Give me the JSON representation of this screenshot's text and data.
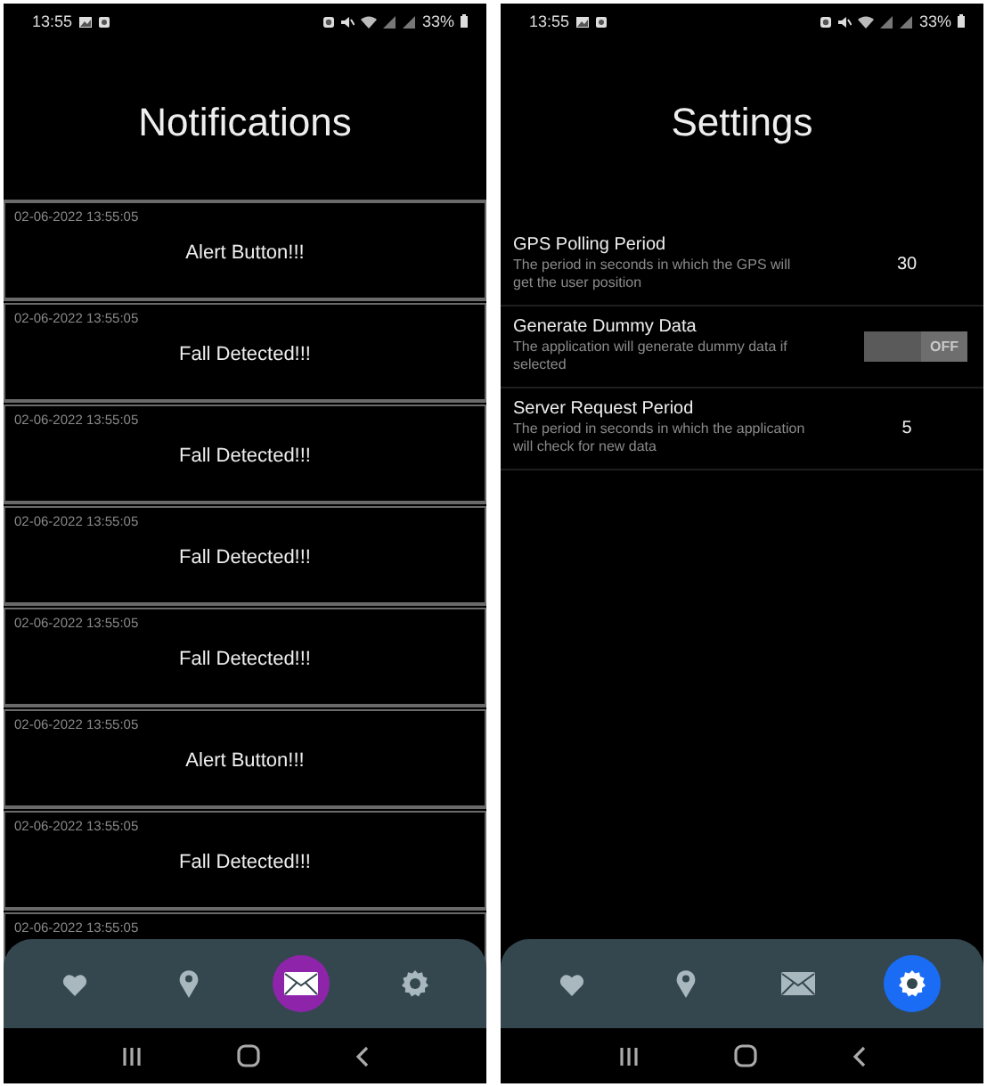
{
  "screens": [
    {
      "status_bar": {
        "time": "13:55",
        "battery": "33%"
      },
      "title": "Notifications",
      "notifications": [
        {
          "time": "02-06-2022 13:55:05",
          "message": "Alert Button!!!"
        },
        {
          "time": "02-06-2022 13:55:05",
          "message": "Fall Detected!!!"
        },
        {
          "time": "02-06-2022 13:55:05",
          "message": "Fall Detected!!!"
        },
        {
          "time": "02-06-2022 13:55:05",
          "message": "Fall Detected!!!"
        },
        {
          "time": "02-06-2022 13:55:05",
          "message": "Fall Detected!!!"
        },
        {
          "time": "02-06-2022 13:55:05",
          "message": "Alert Button!!!"
        },
        {
          "time": "02-06-2022 13:55:05",
          "message": "Fall Detected!!!"
        },
        {
          "time": "02-06-2022 13:55:05"
        }
      ],
      "bottom_nav": [
        {
          "kind": "heart",
          "selected": false
        },
        {
          "kind": "pin",
          "selected": false
        },
        {
          "kind": "mail",
          "selected": true,
          "color": "#8e24aa"
        },
        {
          "kind": "gear",
          "selected": false
        }
      ]
    },
    {
      "status_bar": {
        "time": "13:55",
        "battery": "33%"
      },
      "title": "Settings",
      "settings": [
        {
          "kind": "value",
          "title": "GPS Polling Period",
          "description": "The period in seconds in which the GPS will get the user position",
          "value": "30"
        },
        {
          "kind": "toggle",
          "title": "Generate Dummy Data",
          "description": "The application will generate dummy data if selected",
          "on": false,
          "toggle_label": "OFF"
        },
        {
          "kind": "value",
          "title": "Server Request Period",
          "description": "The period in seconds in which the application will check for new data",
          "value": "5"
        }
      ],
      "bottom_nav": [
        {
          "kind": "heart",
          "selected": false
        },
        {
          "kind": "pin",
          "selected": false
        },
        {
          "kind": "mail",
          "selected": false
        },
        {
          "kind": "gear",
          "selected": true,
          "color": "#1a6cf5"
        }
      ]
    }
  ]
}
